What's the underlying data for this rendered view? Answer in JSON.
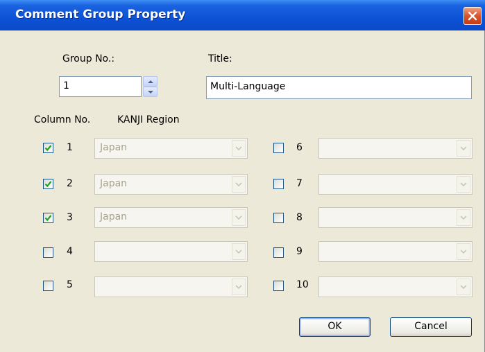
{
  "window": {
    "title": "Comment Group Property"
  },
  "form": {
    "group_no_label": "Group No.:",
    "group_no_value": "1",
    "title_label": "Title:",
    "title_value": "Multi-Language",
    "column_header": "Column No.",
    "kanji_header": "KANJI Region"
  },
  "columns_left": [
    {
      "number": "1",
      "checked": true,
      "region": "Japan"
    },
    {
      "number": "2",
      "checked": true,
      "region": "Japan"
    },
    {
      "number": "3",
      "checked": true,
      "region": "Japan"
    },
    {
      "number": "4",
      "checked": false,
      "region": ""
    },
    {
      "number": "5",
      "checked": false,
      "region": ""
    }
  ],
  "columns_right": [
    {
      "number": "6",
      "checked": false,
      "region": ""
    },
    {
      "number": "7",
      "checked": false,
      "region": ""
    },
    {
      "number": "8",
      "checked": false,
      "region": ""
    },
    {
      "number": "9",
      "checked": false,
      "region": ""
    },
    {
      "number": "10",
      "checked": false,
      "region": ""
    }
  ],
  "buttons": {
    "ok": "OK",
    "cancel": "Cancel"
  },
  "icons": {
    "close": "close-icon",
    "spin_up": "arrow-up-icon",
    "spin_down": "arrow-down-icon",
    "dropdown": "chevron-down-icon",
    "check": "checkmark-icon"
  }
}
